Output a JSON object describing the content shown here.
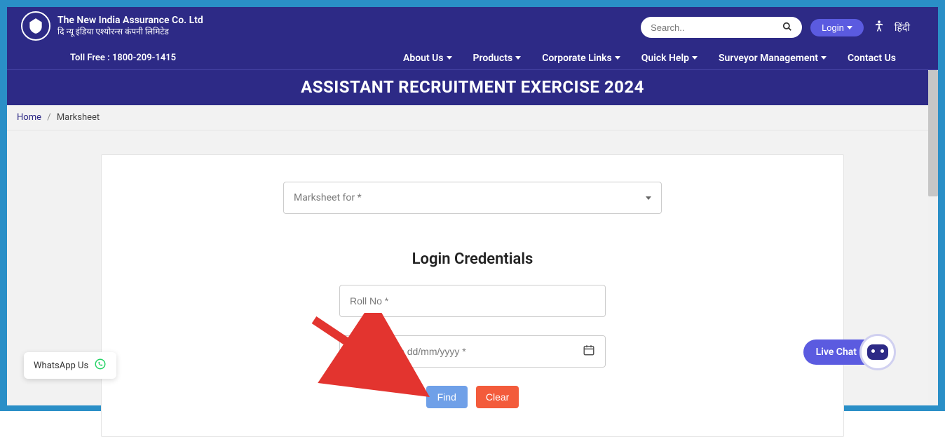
{
  "header": {
    "company_en": "The New India Assurance Co. Ltd",
    "company_hi": "दि न्यू इंडिया एश्योरन्स कंपनी लिमिटेड",
    "search_placeholder": "Search..",
    "login_label": "Login",
    "lang_label": "हिंदी"
  },
  "nav": {
    "tollfree": "Toll Free : 1800-209-1415",
    "items": [
      {
        "label": "About Us",
        "dropdown": true
      },
      {
        "label": "Products",
        "dropdown": true
      },
      {
        "label": "Corporate Links",
        "dropdown": true
      },
      {
        "label": "Quick Help",
        "dropdown": true
      },
      {
        "label": "Surveyor Management",
        "dropdown": true
      },
      {
        "label": "Contact Us",
        "dropdown": false
      }
    ]
  },
  "page_title": "ASSISTANT RECRUITMENT EXERCISE 2024",
  "breadcrumb": {
    "home": "Home",
    "current": "Marksheet"
  },
  "form": {
    "marksheet_select_label": "Marksheet for *",
    "section_title": "Login Credentials",
    "rollno_placeholder": "Roll No *",
    "dob_placeholder": "Date of Birth dd/mm/yyyy *",
    "find_label": "Find",
    "clear_label": "Clear"
  },
  "floaters": {
    "whatsapp": "WhatsApp Us",
    "livechat": "Live Chat"
  },
  "colors": {
    "primary": "#2d2a86",
    "accent": "#5b5be0",
    "border_frame": "#2a8fc7",
    "find_btn": "#6fa0e8",
    "clear_btn": "#f35b3b"
  }
}
